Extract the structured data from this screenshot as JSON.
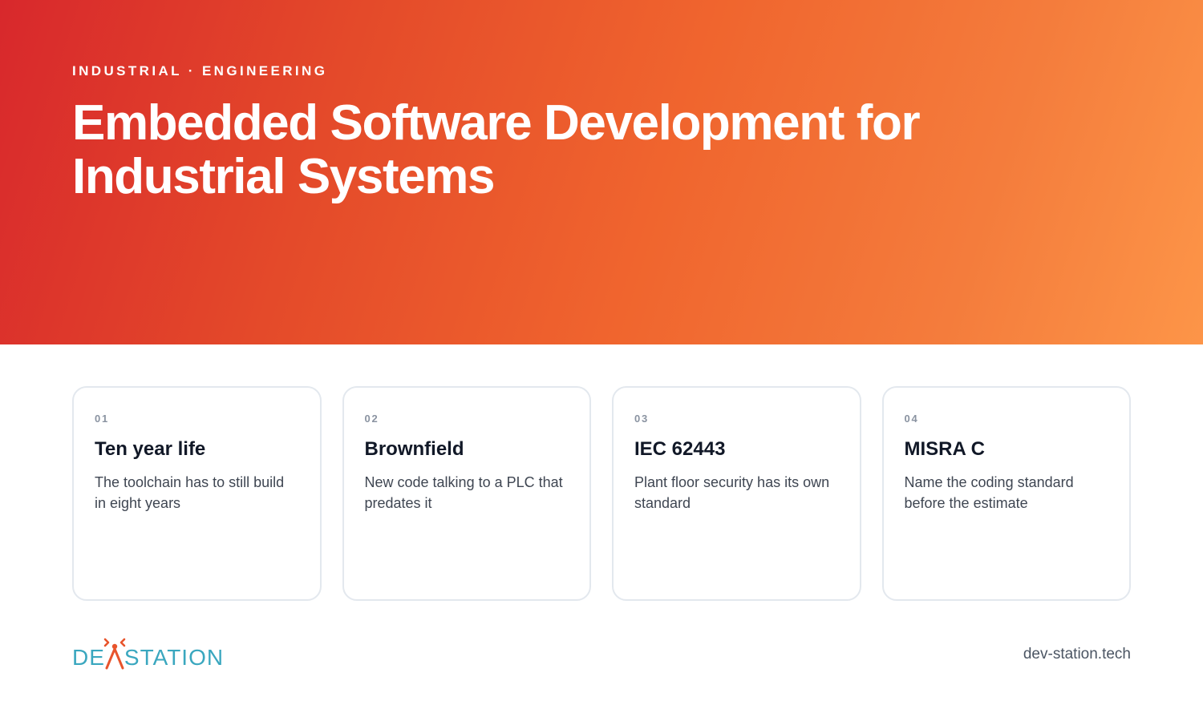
{
  "hero": {
    "eyebrow": "INDUSTRIAL · ENGINEERING",
    "title": "Embedded Software Development for Industrial Systems",
    "gradient_start": "#d8282c",
    "gradient_end": "#fd9548"
  },
  "cards": [
    {
      "number": "01",
      "title": "Ten year life",
      "text": "The toolchain has to still build in eight years"
    },
    {
      "number": "02",
      "title": "Brownfield",
      "text": "New code talking to a PLC that predates it"
    },
    {
      "number": "03",
      "title": "IEC 62443",
      "text": "Plant floor security has its own standard"
    },
    {
      "number": "04",
      "title": "MISRA C",
      "text": "Name the coding standard before the estimate"
    }
  ],
  "footer": {
    "logo": {
      "text_left": "DE",
      "text_right": "STATION",
      "color_text": "#3aa7bf",
      "color_mark": "#e8542c",
      "icon": "devstation-x-logo-icon"
    },
    "url": "dev-station.tech"
  }
}
